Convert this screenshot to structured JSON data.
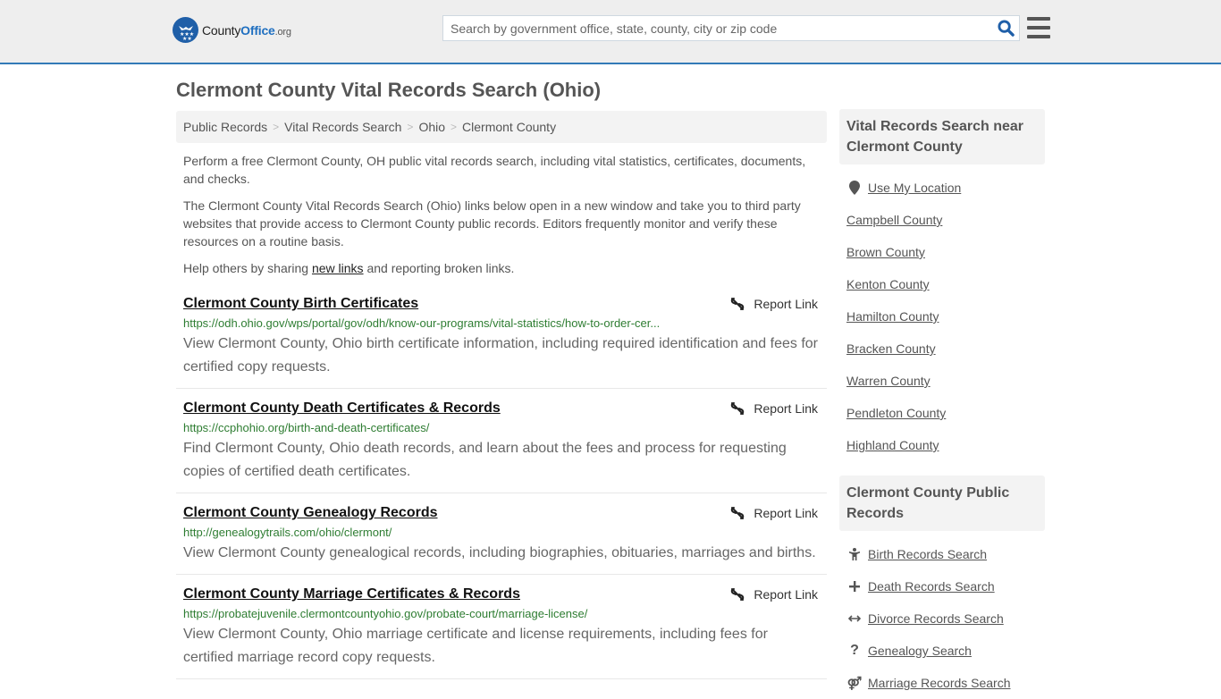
{
  "header": {
    "logo": {
      "county": "County",
      "office": "Office",
      "org": ".org"
    },
    "search": {
      "placeholder": "Search by government office, state, county, city or zip code",
      "value": ""
    },
    "accent_color": "#337ab7"
  },
  "page": {
    "title": "Clermont County Vital Records Search (Ohio)"
  },
  "breadcrumb": [
    {
      "label": "Public Records"
    },
    {
      "label": "Vital Records Search"
    },
    {
      "label": "Ohio"
    },
    {
      "label": "Clermont County"
    }
  ],
  "intro": {
    "p1": "Perform a free Clermont County, OH public vital records search, including vital statistics, certificates, documents, and checks.",
    "p2": "The Clermont County Vital Records Search (Ohio) links below open in a new window and take you to third party websites that provide access to Clermont County public records. Editors frequently monitor and verify these resources on a routine basis.",
    "p3_before": "Help others by sharing ",
    "p3_link": "new links",
    "p3_after": " and reporting broken links."
  },
  "results": [
    {
      "title": "Clermont County Birth Certificates",
      "url": "https://odh.ohio.gov/wps/portal/gov/odh/know-our-programs/vital-statistics/how-to-order-cer...",
      "description": "View Clermont County, Ohio birth certificate information, including required identification and fees for certified copy requests.",
      "report_label": "Report Link"
    },
    {
      "title": "Clermont County Death Certificates & Records",
      "url": "https://ccphohio.org/birth-and-death-certificates/",
      "description": "Find Clermont County, Ohio death records, and learn about the fees and process for requesting copies of certified death certificates.",
      "report_label": "Report Link"
    },
    {
      "title": "Clermont County Genealogy Records",
      "url": "http://genealogytrails.com/ohio/clermont/",
      "description": "View Clermont County genealogical records, including biographies, obituaries, marriages and births.",
      "report_label": "Report Link"
    },
    {
      "title": "Clermont County Marriage Certificates & Records",
      "url": "https://probatejuvenile.clermontcountyohio.gov/probate-court/marriage-license/",
      "description": "View Clermont County, Ohio marriage certificate and license requirements, including fees for certified marriage record copy requests.",
      "report_label": "Report Link"
    }
  ],
  "sidebar": {
    "nearby": {
      "heading": "Vital Records Search near Clermont County",
      "use_location": "Use My Location",
      "counties": [
        "Campbell County",
        "Brown County",
        "Kenton County",
        "Hamilton County",
        "Bracken County",
        "Warren County",
        "Pendleton County",
        "Highland County"
      ]
    },
    "public_records": {
      "heading": "Clermont County Public Records",
      "items": [
        {
          "label": "Birth Records Search",
          "icon": "child-icon"
        },
        {
          "label": "Death Records Search",
          "icon": "plus-icon"
        },
        {
          "label": "Divorce Records Search",
          "icon": "arrows-horizontal-icon"
        },
        {
          "label": "Genealogy Search",
          "icon": "question-icon"
        },
        {
          "label": "Marriage Records Search",
          "icon": "marriage-icon"
        }
      ]
    }
  }
}
